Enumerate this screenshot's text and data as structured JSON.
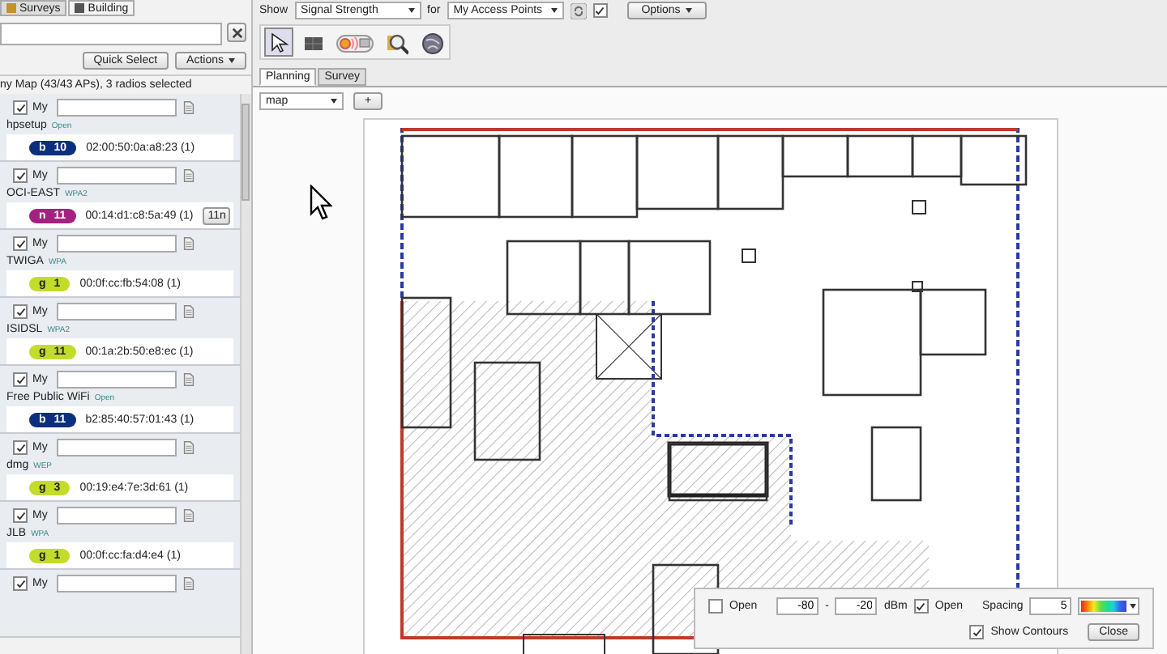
{
  "left_panel": {
    "tabs": [
      {
        "label": "Surveys",
        "selected": false
      },
      {
        "label": "Building",
        "selected": true
      }
    ],
    "buttons": [
      {
        "label": "Quick Select",
        "kind": "plain"
      },
      {
        "label": "Actions",
        "kind": "menu"
      }
    ],
    "summary": "ny Map (43/43 APs), 3 radios selected",
    "access_points": [
      {
        "kind": "full",
        "my_checked": true,
        "my_label": "My",
        "name": "hpsetup",
        "security": "Open",
        "band": "b",
        "channel": "10",
        "color": "#0b2f7e",
        "mac": "02:00:50:0a:a8:23 (1)"
      },
      {
        "kind": "full",
        "my_checked": true,
        "my_label": "My",
        "name": "OCI-EAST",
        "security": "WPA2",
        "band": "n",
        "channel": "11",
        "color": "#a3227f",
        "mac": "00:14:d1:c8:5a:49 (1)",
        "extra": "11n"
      },
      {
        "kind": "full",
        "my_checked": true,
        "my_label": "My",
        "name": "TWIGA",
        "security": "WPA",
        "band": "g",
        "channel": "1",
        "color": "#c3dc2c",
        "mac": "00:0f:cc:fb:54:08 (1)"
      },
      {
        "kind": "full",
        "my_checked": true,
        "my_label": "My",
        "name": "ISIDSL",
        "security": "WPA2",
        "band": "g",
        "channel": "11",
        "color": "#c3dc2c",
        "mac": "00:1a:2b:50:e8:ec (1)"
      },
      {
        "kind": "full",
        "my_checked": true,
        "my_label": "My",
        "name": "Free Public WiFi",
        "security": "Open",
        "band": "b",
        "channel": "11",
        "color": "#0b2f7e",
        "mac": "b2:85:40:57:01:43 (1)"
      },
      {
        "kind": "full",
        "my_checked": true,
        "my_label": "My",
        "name": "dmg",
        "security": "WEP",
        "band": "g",
        "channel": "3",
        "color": "#c3dc2c",
        "mac": "00:19:e4:7e:3d:61 (1)"
      },
      {
        "kind": "full",
        "my_checked": true,
        "my_label": "My",
        "name": "JLB",
        "security": "WPA",
        "band": "g",
        "channel": "1",
        "color": "#c3dc2c",
        "mac": "00:0f:cc:fa:d4:e4 (1)"
      },
      {
        "kind": "partial",
        "my_checked": true,
        "my_label": "My"
      }
    ]
  },
  "toolbar": {
    "show_label": "Show",
    "show_value": "Signal Strength",
    "for_label": "for",
    "for_value": "My Access Points",
    "sync_checked": true,
    "options": "Options"
  },
  "tools": [
    {
      "kind": "pointer",
      "selected": true
    },
    {
      "kind": "grid",
      "selected": false
    },
    {
      "kind": "radio",
      "selected": false
    },
    {
      "kind": "search",
      "selected": false
    },
    {
      "kind": "globe",
      "selected": false
    }
  ],
  "view_tabs": [
    {
      "label": "Planning",
      "selected": true
    },
    {
      "label": "Survey",
      "selected": false
    }
  ],
  "map_select": "map",
  "add_button": "+",
  "heatmap_panel": {
    "min_open_checked": false,
    "min_open_label": "Open",
    "min": "-80",
    "separator": "-",
    "max": "-20",
    "unit": "dBm",
    "max_open_checked": true,
    "max_open_label": "Open",
    "spacing_label": "Spacing",
    "spacing": "5",
    "show_contours_checked": true,
    "show_contours_label": "Show Contours",
    "close": "Close"
  }
}
